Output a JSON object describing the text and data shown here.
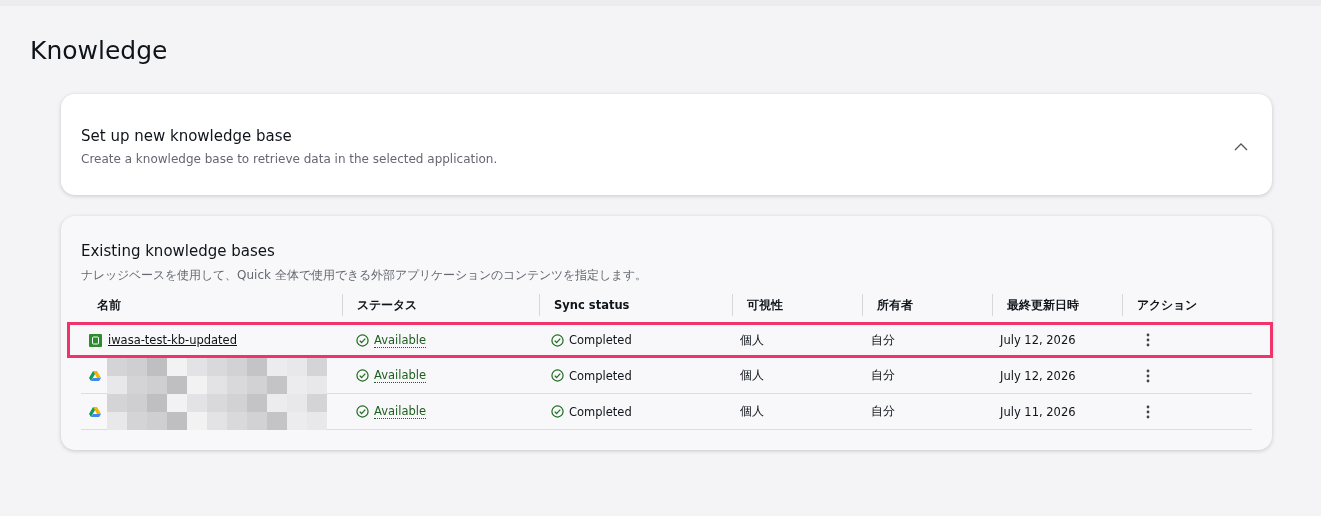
{
  "page_title": "Knowledge",
  "setup_panel": {
    "title": "Set up new knowledge base",
    "description": "Create a knowledge base to retrieve data in the selected application.",
    "expanded": true
  },
  "existing_panel": {
    "title": "Existing knowledge bases",
    "description": "ナレッジベースを使用して、Quick 全体で使用できる外部アプリケーションのコンテンツを指定します。",
    "table": {
      "columns": [
        "名前",
        "ステータス",
        "Sync status",
        "可視性",
        "所有者",
        "最終更新日時",
        "アクション"
      ],
      "rows": [
        {
          "kind": "kb",
          "name": "iwasa-test-kb-updated",
          "redacted": false,
          "highlighted": true,
          "status": "Available",
          "sync_status": "Completed",
          "visibility": "個人",
          "owner": "自分",
          "last_updated": "July 12, 2026"
        },
        {
          "kind": "drive",
          "redacted": true,
          "highlighted": false,
          "status": "Available",
          "sync_status": "Completed",
          "visibility": "個人",
          "owner": "自分",
          "last_updated": "July 12, 2026"
        },
        {
          "kind": "drive",
          "redacted": true,
          "highlighted": false,
          "status": "Available",
          "sync_status": "Completed",
          "visibility": "個人",
          "owner": "自分",
          "last_updated": "July 11, 2026"
        }
      ]
    }
  }
}
